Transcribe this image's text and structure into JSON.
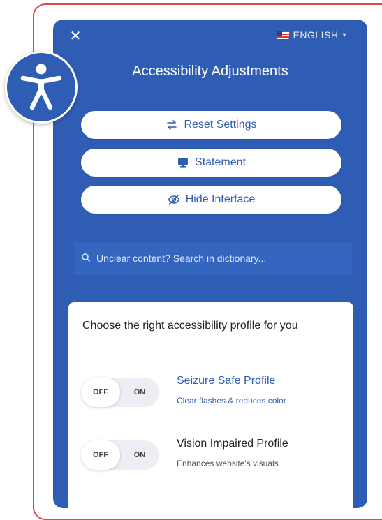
{
  "panel": {
    "language": "ENGLISH",
    "title": "Accessibility Adjustments",
    "buttons": {
      "reset": "Reset Settings",
      "statement": "Statement",
      "hide": "Hide Interface"
    },
    "search_placeholder": "Unclear content? Search in dictionary..."
  },
  "profiles_card": {
    "heading": "Choose the right accessibility profile for you",
    "toggle_off": "OFF",
    "toggle_on": "ON",
    "items": [
      {
        "name": "Seizure Safe Profile",
        "description": "Clear flashes & reduces color"
      },
      {
        "name": "Vision Impaired Profile",
        "description": "Enhances website's visuals"
      }
    ]
  },
  "icons": {
    "close": "close-icon",
    "flag": "us-flag-icon",
    "reset": "reset-arrows-icon",
    "statement": "monitor-icon",
    "hide": "eye-slash-icon",
    "search": "search-icon",
    "accessibility": "accessibility-person-icon"
  },
  "colors": {
    "panel_blue": "#2f5db3",
    "frame_red": "#d94a4a",
    "white": "#ffffff"
  }
}
